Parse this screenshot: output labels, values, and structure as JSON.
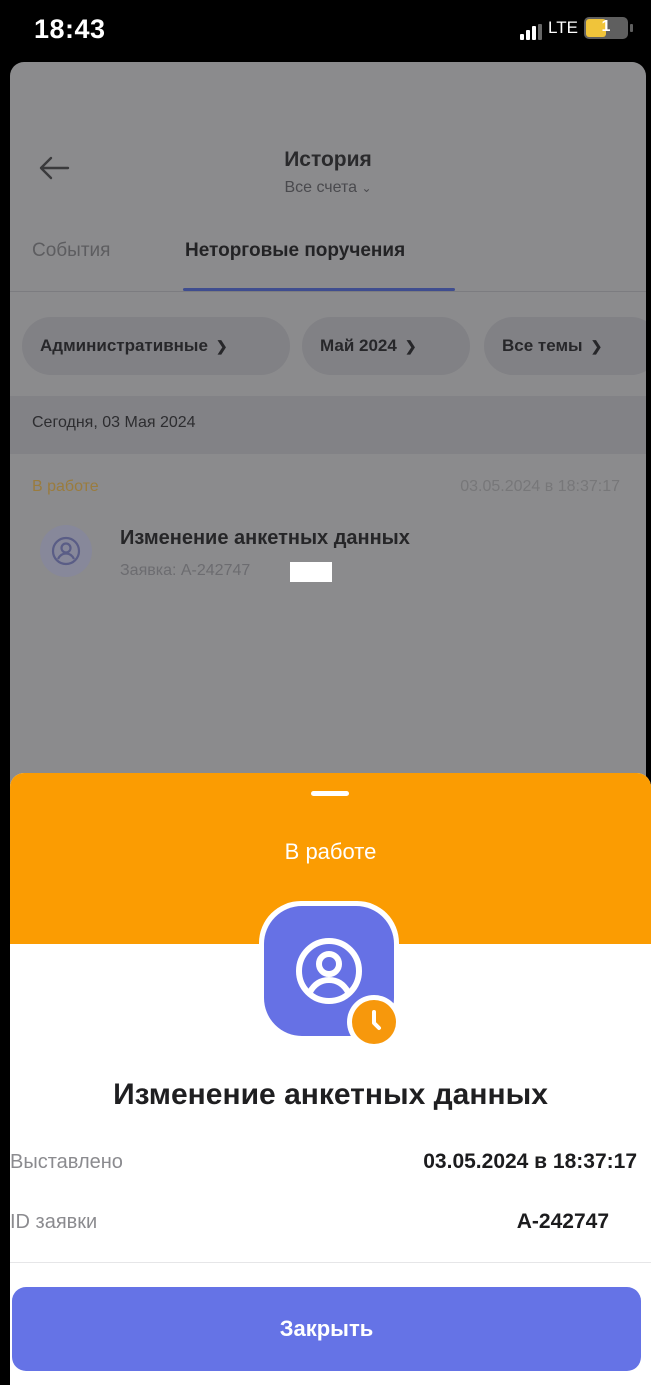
{
  "status_bar": {
    "time": "18:43",
    "network": "LTE",
    "battery": "1"
  },
  "header": {
    "title": "История",
    "subtitle": "Все счета"
  },
  "tabs": [
    "События",
    "Неторговые поручения"
  ],
  "filters": [
    "Административные",
    "Май 2024",
    "Все темы"
  ],
  "list": {
    "date_heading": "Сегодня, 03 Мая 2024",
    "item": {
      "status": "В работе",
      "datetime": "03.05.2024 в 18:37:17",
      "title": "Изменение анкетных данных",
      "subtitle": "Заявка: А-242747"
    }
  },
  "sheet": {
    "status": "В работе",
    "title": "Изменение анкетных данных",
    "rows": [
      {
        "label": "Выставлено",
        "value": "03.05.2024 в 18:37:17"
      },
      {
        "label": "ID заявки",
        "value": "А-242747"
      }
    ],
    "close_label": "Закрыть"
  },
  "colors": {
    "accent": "#6573E6",
    "status_orange": "#FB9C02"
  }
}
